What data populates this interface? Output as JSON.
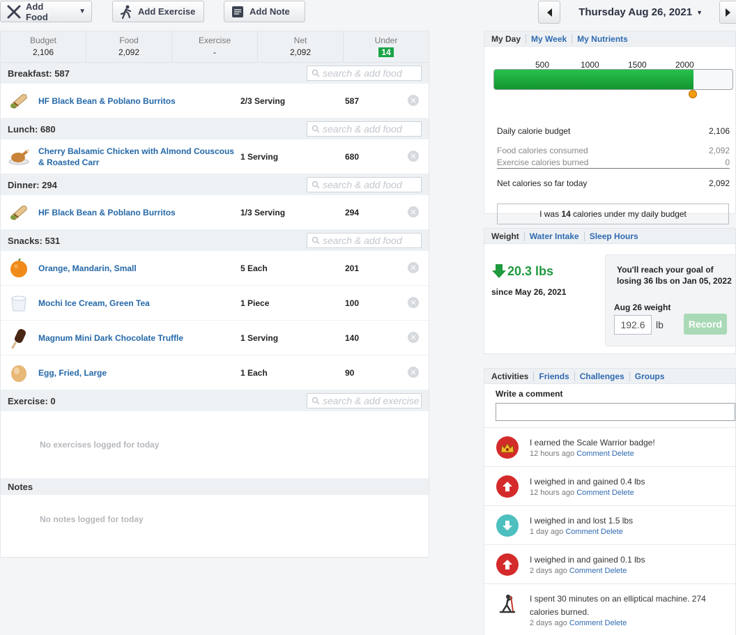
{
  "toolbar": {
    "add_food": "Add Food",
    "add_exercise": "Add Exercise",
    "add_note": "Add Note",
    "date": "Thursday Aug 26, 2021"
  },
  "summary": {
    "budget_label": "Budget",
    "budget": "2,106",
    "food_label": "Food",
    "food": "2,092",
    "exercise_label": "Exercise",
    "exercise": "-",
    "net_label": "Net",
    "net": "2,092",
    "under_label": "Under",
    "under": "14"
  },
  "search_placeholder": "search & add food",
  "exercise_placeholder": "search & add exercise",
  "meals": {
    "breakfast": {
      "title": "Breakfast: 587",
      "items": [
        {
          "name": "HF Black Bean & Poblano Burritos",
          "qty": "2/3 Serving",
          "cal": "587"
        }
      ]
    },
    "lunch": {
      "title": "Lunch: 680",
      "items": [
        {
          "name": "Cherry Balsamic Chicken with Almond Couscous & Roasted Carr",
          "qty": "1 Serving",
          "cal": "680"
        }
      ]
    },
    "dinner": {
      "title": "Dinner: 294",
      "items": [
        {
          "name": "HF Black Bean & Poblano Burritos",
          "qty": "1/3 Serving",
          "cal": "294"
        }
      ]
    },
    "snacks": {
      "title": "Snacks: 531",
      "items": [
        {
          "name": "Orange, Mandarin, Small",
          "qty": "5 Each",
          "cal": "201"
        },
        {
          "name": "Mochi Ice Cream, Green Tea",
          "qty": "1 Piece",
          "cal": "100"
        },
        {
          "name": "Magnum Mini Dark Chocolate Truffle",
          "qty": "1 Serving",
          "cal": "140"
        },
        {
          "name": "Egg, Fried, Large",
          "qty": "1 Each",
          "cal": "90"
        }
      ]
    }
  },
  "exercise": {
    "title": "Exercise: 0",
    "empty": "No exercises logged for today"
  },
  "notes": {
    "title": "Notes",
    "empty": "No notes logged for today"
  },
  "myday": {
    "tabs": [
      "My Day",
      "My Week",
      "My Nutrients"
    ],
    "ticks": [
      "500",
      "1000",
      "1500",
      "2000"
    ],
    "progress_fraction": 0.9934,
    "rows": {
      "budget_label": "Daily calorie budget",
      "budget": "2,106",
      "food_label": "Food calories consumed",
      "food": "2,092",
      "exercise_label": "Exercise calories burned",
      "exercise": "0",
      "net_label": "Net calories so far today",
      "net": "2,092"
    },
    "status_pre": "I was ",
    "status_num": "14",
    "status_post": " calories under my daily budget"
  },
  "weight": {
    "tabs": [
      "Weight",
      "Water Intake",
      "Sleep Hours"
    ],
    "change": "20.3 lbs",
    "since": "since May 26, 2021",
    "goal_text": "You'll reach your goal of losing 36 lbs on Jan 05, 2022",
    "date_label": "Aug 26 weight",
    "value": "192.6",
    "unit": "lb",
    "record": "Record"
  },
  "activities": {
    "tabs": [
      "Activities",
      "Friends",
      "Challenges",
      "Groups"
    ],
    "write_label": "Write a comment",
    "comment_link": "Comment",
    "delete_link": "Delete",
    "items": [
      {
        "text": "I earned the Scale Warrior badge!",
        "time": "12 hours ago"
      },
      {
        "text": "I weighed in and gained 0.4 lbs",
        "time": "12 hours ago"
      },
      {
        "text": "I weighed in and lost 1.5 lbs",
        "time": "1 day ago"
      },
      {
        "text": "I weighed in and gained 0.1 lbs",
        "time": "2 days ago"
      },
      {
        "text": "I spent 30 minutes on an elliptical machine. 274 calories burned.",
        "time": "2 days ago"
      }
    ]
  },
  "colors": {
    "accent_green": "#1aa548",
    "link_blue": "#2468a8",
    "red": "#d42a2a",
    "teal": "#4dbfbf"
  }
}
